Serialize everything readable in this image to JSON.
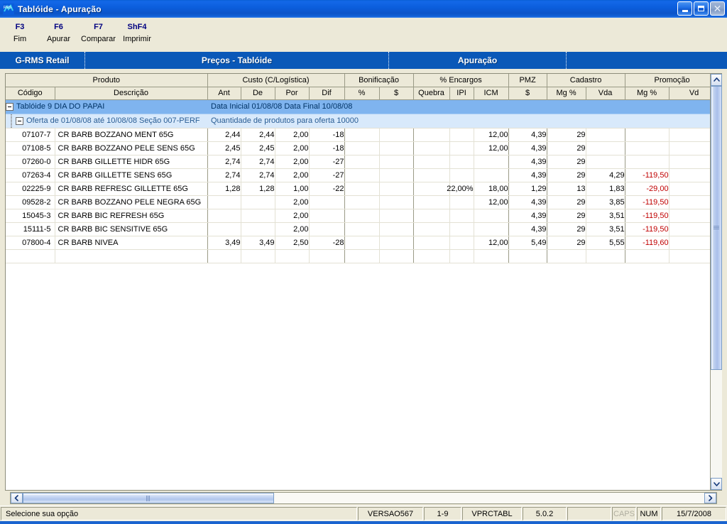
{
  "window": {
    "title": "Tablóide - Apuração",
    "icon": "rms-app-icon",
    "buttons": {
      "minimize": "minimize-icon",
      "maximize": "restore-icon",
      "close": "close-icon"
    }
  },
  "function_keys": [
    {
      "key": "F3",
      "label": "Fim"
    },
    {
      "key": "F6",
      "label": "Apurar"
    },
    {
      "key": "F7",
      "label": "Comparar"
    },
    {
      "key": "ShF4",
      "label": "Imprimir"
    }
  ],
  "tabs": [
    {
      "label": "G-RMS Retail"
    },
    {
      "label": "Preços - Tablóide"
    },
    {
      "label": "Apuração"
    }
  ],
  "grid": {
    "header_groups": [
      {
        "label": "Produto",
        "span": 2
      },
      {
        "label": "Custo (C/Logística)",
        "span": 4
      },
      {
        "label": "Bonificação",
        "span": 2
      },
      {
        "label": "% Encargos",
        "span": 3
      },
      {
        "label": "PMZ",
        "span": 1
      },
      {
        "label": "Cadastro",
        "span": 2
      },
      {
        "label": "Promoção",
        "span": 2
      }
    ],
    "columns": [
      "Código",
      "Descrição",
      "Ant",
      "De",
      "Por",
      "Dif",
      "%",
      "$",
      "Quebra",
      "IPI",
      "ICM",
      "$",
      "Mg %",
      "Vda",
      "Mg %",
      "Vd"
    ],
    "group_rows": [
      {
        "level": 1,
        "label": "Tablóide 9 DIA DO PAPAI",
        "detail": "Data Inicial 01/08/08  Data Final 10/08/08",
        "expanded": true
      },
      {
        "level": 2,
        "label": "Oferta de 01/08/08 até 10/08/08  Seção 007-PERF",
        "detail": "Quantidade de produtos para oferta 10000",
        "expanded": true
      }
    ],
    "rows": [
      {
        "codigo": "07107-7",
        "descricao": "CR BARB BOZZANO MENT 65G",
        "ant": "2,44",
        "de": "2,44",
        "por": "2,00",
        "dif": "-18",
        "bon_pct": "",
        "bon_val": "",
        "quebra": "",
        "ipi": "",
        "icm": "12,00",
        "pmz": "4,39",
        "cad_mg": "29",
        "cad_vda": "",
        "promo_mg": "",
        "promo_vda": ""
      },
      {
        "codigo": "07108-5",
        "descricao": "CR BARB BOZZANO PELE SENS 65G",
        "ant": "2,45",
        "de": "2,45",
        "por": "2,00",
        "dif": "-18",
        "bon_pct": "",
        "bon_val": "",
        "quebra": "",
        "ipi": "",
        "icm": "12,00",
        "pmz": "4,39",
        "cad_mg": "29",
        "cad_vda": "",
        "promo_mg": "",
        "promo_vda": ""
      },
      {
        "codigo": "07260-0",
        "descricao": "CR BARB GILLETTE HIDR 65G",
        "ant": "2,74",
        "de": "2,74",
        "por": "2,00",
        "dif": "-27",
        "bon_pct": "",
        "bon_val": "",
        "quebra": "",
        "ipi": "",
        "icm": "",
        "pmz": "4,39",
        "cad_mg": "29",
        "cad_vda": "",
        "promo_mg": "",
        "promo_vda": ""
      },
      {
        "codigo": "07263-4",
        "descricao": "CR BARB GILLETTE SENS 65G",
        "ant": "2,74",
        "de": "2,74",
        "por": "2,00",
        "dif": "-27",
        "bon_pct": "",
        "bon_val": "",
        "quebra": "",
        "ipi": "",
        "icm": "",
        "pmz": "4,39",
        "cad_mg": "29",
        "cad_vda": "4,29",
        "promo_mg": "-119,50",
        "promo_vda": ""
      },
      {
        "codigo": "02225-9",
        "descricao": "CR BARB REFRESC GILLETTE 65G",
        "ant": "1,28",
        "de": "1,28",
        "por": "1,00",
        "dif": "-22",
        "bon_pct": "",
        "bon_val": "",
        "quebra": "",
        "ipi": "22,00%",
        "icm": "18,00",
        "pmz": "1,29",
        "cad_mg": "13",
        "cad_vda": "1,83",
        "promo_mg": "-29,00",
        "promo_vda": ""
      },
      {
        "codigo": "09528-2",
        "descricao": "CR BARB BOZZANO PELE NEGRA 65G",
        "ant": "",
        "de": "",
        "por": "2,00",
        "dif": "",
        "bon_pct": "",
        "bon_val": "",
        "quebra": "",
        "ipi": "",
        "icm": "12,00",
        "pmz": "4,39",
        "cad_mg": "29",
        "cad_vda": "3,85",
        "promo_mg": "-119,50",
        "promo_vda": ""
      },
      {
        "codigo": "15045-3",
        "descricao": "CR BARB BIC REFRESH 65G",
        "ant": "",
        "de": "",
        "por": "2,00",
        "dif": "",
        "bon_pct": "",
        "bon_val": "",
        "quebra": "",
        "ipi": "",
        "icm": "",
        "pmz": "4,39",
        "cad_mg": "29",
        "cad_vda": "3,51",
        "promo_mg": "-119,50",
        "promo_vda": ""
      },
      {
        "codigo": "15111-5",
        "descricao": "CR BARB BIC SENSITIVE 65G",
        "ant": "",
        "de": "",
        "por": "2,00",
        "dif": "",
        "bon_pct": "",
        "bon_val": "",
        "quebra": "",
        "ipi": "",
        "icm": "",
        "pmz": "4,39",
        "cad_mg": "29",
        "cad_vda": "3,51",
        "promo_mg": "-119,50",
        "promo_vda": ""
      },
      {
        "codigo": "07800-4",
        "descricao": "CR BARB NIVEA",
        "ant": "3,49",
        "de": "3,49",
        "por": "2,50",
        "dif": "-28",
        "bon_pct": "",
        "bon_val": "",
        "quebra": "",
        "ipi": "",
        "icm": "12,00",
        "pmz": "5,49",
        "cad_mg": "29",
        "cad_vda": "5,55",
        "promo_mg": "-119,60",
        "promo_vda": ""
      }
    ]
  },
  "scrollbars": {
    "vertical": {
      "up": "chevron-up-icon",
      "down": "chevron-down-icon",
      "thumb": "vertical-scroll-thumb"
    },
    "horizontal": {
      "left": "chevron-left-icon",
      "right": "chevron-right-icon",
      "thumb": "horizontal-scroll-thumb"
    }
  },
  "statusbar": {
    "message": "Selecione sua opção",
    "version": "VERSAO567",
    "range": "1-9",
    "program": "VPRCTABL",
    "release": "5.0.2",
    "spacer": "",
    "caps": "CAPS",
    "num": "NUM",
    "date": "15/7/2008"
  },
  "colors": {
    "titlebar_blue": "#0b5ddb",
    "tab_blue": "#0a58b8",
    "chrome": "#ece9d8",
    "group1": "#7fb4ef",
    "group2": "#d8e9fb",
    "negative": "#c00000"
  }
}
